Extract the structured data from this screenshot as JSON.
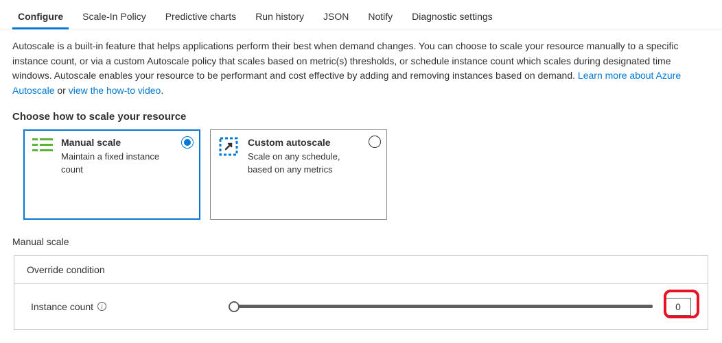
{
  "tabs": [
    {
      "label": "Configure",
      "active": true
    },
    {
      "label": "Scale-In Policy",
      "active": false
    },
    {
      "label": "Predictive charts",
      "active": false
    },
    {
      "label": "Run history",
      "active": false
    },
    {
      "label": "JSON",
      "active": false
    },
    {
      "label": "Notify",
      "active": false
    },
    {
      "label": "Diagnostic settings",
      "active": false
    }
  ],
  "description": {
    "text1": "Autoscale is a built-in feature that helps applications perform their best when demand changes. You can choose to scale your resource manually to a specific instance count, or via a custom Autoscale policy that scales based on metric(s) thresholds, or schedule instance count which scales during designated time windows. Autoscale enables your resource to be performant and cost effective by adding and removing instances based on demand. ",
    "link1": "Learn more about Azure Autoscale",
    "mid": " or ",
    "link2": "view the how-to video",
    "end": "."
  },
  "choose_title": "Choose how to scale your resource",
  "choices": {
    "manual": {
      "title": "Manual scale",
      "desc": "Maintain a fixed instance count"
    },
    "custom": {
      "title": "Custom autoscale",
      "desc": "Scale on any schedule, based on any metrics"
    }
  },
  "manual_section_label": "Manual scale",
  "condition": {
    "header": "Override condition",
    "instance_label": "Instance count",
    "value": "0"
  }
}
